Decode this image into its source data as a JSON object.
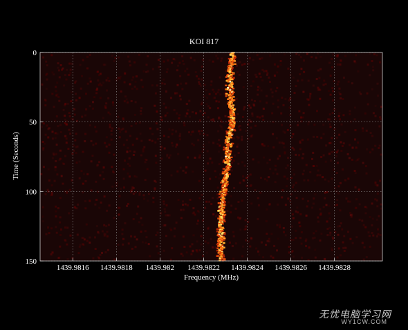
{
  "chart_data": {
    "type": "heatmap",
    "title": "KOI 817",
    "xlabel": "Frequency (MHz)",
    "ylabel": "Time (Seconds)",
    "xlim": [
      1439.98145,
      1439.98302
    ],
    "ylim": [
      0,
      150
    ],
    "y_inverted": true,
    "x_ticks": [
      1439.9816,
      1439.9818,
      1439.982,
      1439.9822,
      1439.9824,
      1439.9826,
      1439.9828
    ],
    "x_tick_labels": [
      "1439.9816",
      "1439.9818",
      "1439.982",
      "1439.9822",
      "1439.9824",
      "1439.9826",
      "1439.9828"
    ],
    "y_ticks": [
      0,
      50,
      100,
      150
    ],
    "y_tick_labels": [
      "0",
      "50",
      "100",
      "150"
    ],
    "grid": true,
    "colormap": "hot",
    "colors": {
      "background": "#000000",
      "plot_background": "#1a0606",
      "grid": "#8a8a8a",
      "signal_core": "#ffe066",
      "signal_edge": "#d43a0a"
    },
    "signal_track": {
      "time": [
        0,
        10,
        20,
        30,
        40,
        50,
        60,
        70,
        80,
        90,
        100,
        110,
        120,
        130,
        140,
        150
      ],
      "frequency": [
        1439.98233,
        1439.98233,
        1439.98232,
        1439.98232,
        1439.98233,
        1439.98233,
        1439.98232,
        1439.98231,
        1439.98231,
        1439.9823,
        1439.98229,
        1439.98228,
        1439.98228,
        1439.98228,
        1439.98228,
        1439.98228
      ]
    }
  },
  "watermark": {
    "text": "无忧电脑学习网",
    "url": "WY1CW.COM"
  }
}
